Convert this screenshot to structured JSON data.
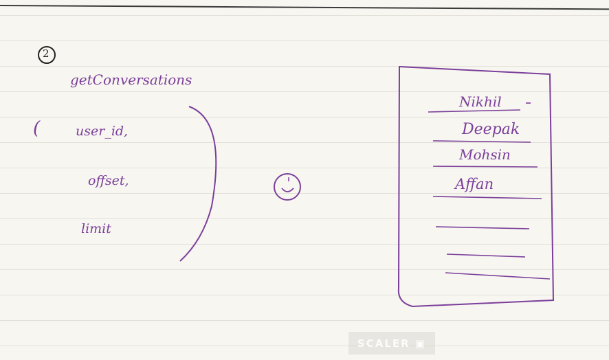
{
  "step_number": "2",
  "function_name": "getConversations",
  "params": [
    "user_id,",
    "offset,",
    "limit"
  ],
  "open_paren": "(",
  "conversation_list": [
    "Nikhil",
    "Deepak",
    "Mohsin",
    "Affan"
  ],
  "watermark": "SCALER",
  "ink_color": "#7b3f9a"
}
